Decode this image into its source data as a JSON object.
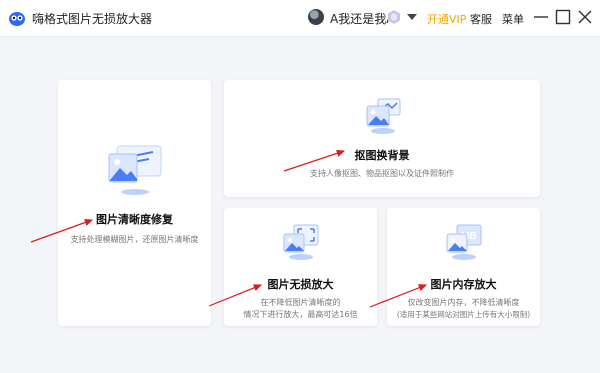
{
  "app": {
    "title": "嗨格式图片无损放大器"
  },
  "user": {
    "name": "A我还是我A"
  },
  "header": {
    "vip_label": "开通VIP",
    "service_label": "客服",
    "menu_label": "菜单"
  },
  "cards": {
    "restore": {
      "title": "图片清晰度修复",
      "desc": "支持处理模糊图片，还原图片清晰度"
    },
    "background": {
      "title": "抠图换背景",
      "desc": "支持人像抠图、物品抠图以及证件照制作"
    },
    "lossless": {
      "title": "图片无损放大",
      "desc_line1": "在不降低图片清晰度的",
      "desc_line2": "情况下进行放大，最高可达16倍"
    },
    "memory": {
      "title": "图片内存放大",
      "desc_line1": "仅改变图片内存，不降低清晰度",
      "desc_line2": "(适用于某些网站对图片上传有大小限制)",
      "icon_text": "MB"
    }
  },
  "colors": {
    "accent": "#4a7cf6",
    "vip": "#f2a600",
    "arrow": "#d81e1e"
  }
}
